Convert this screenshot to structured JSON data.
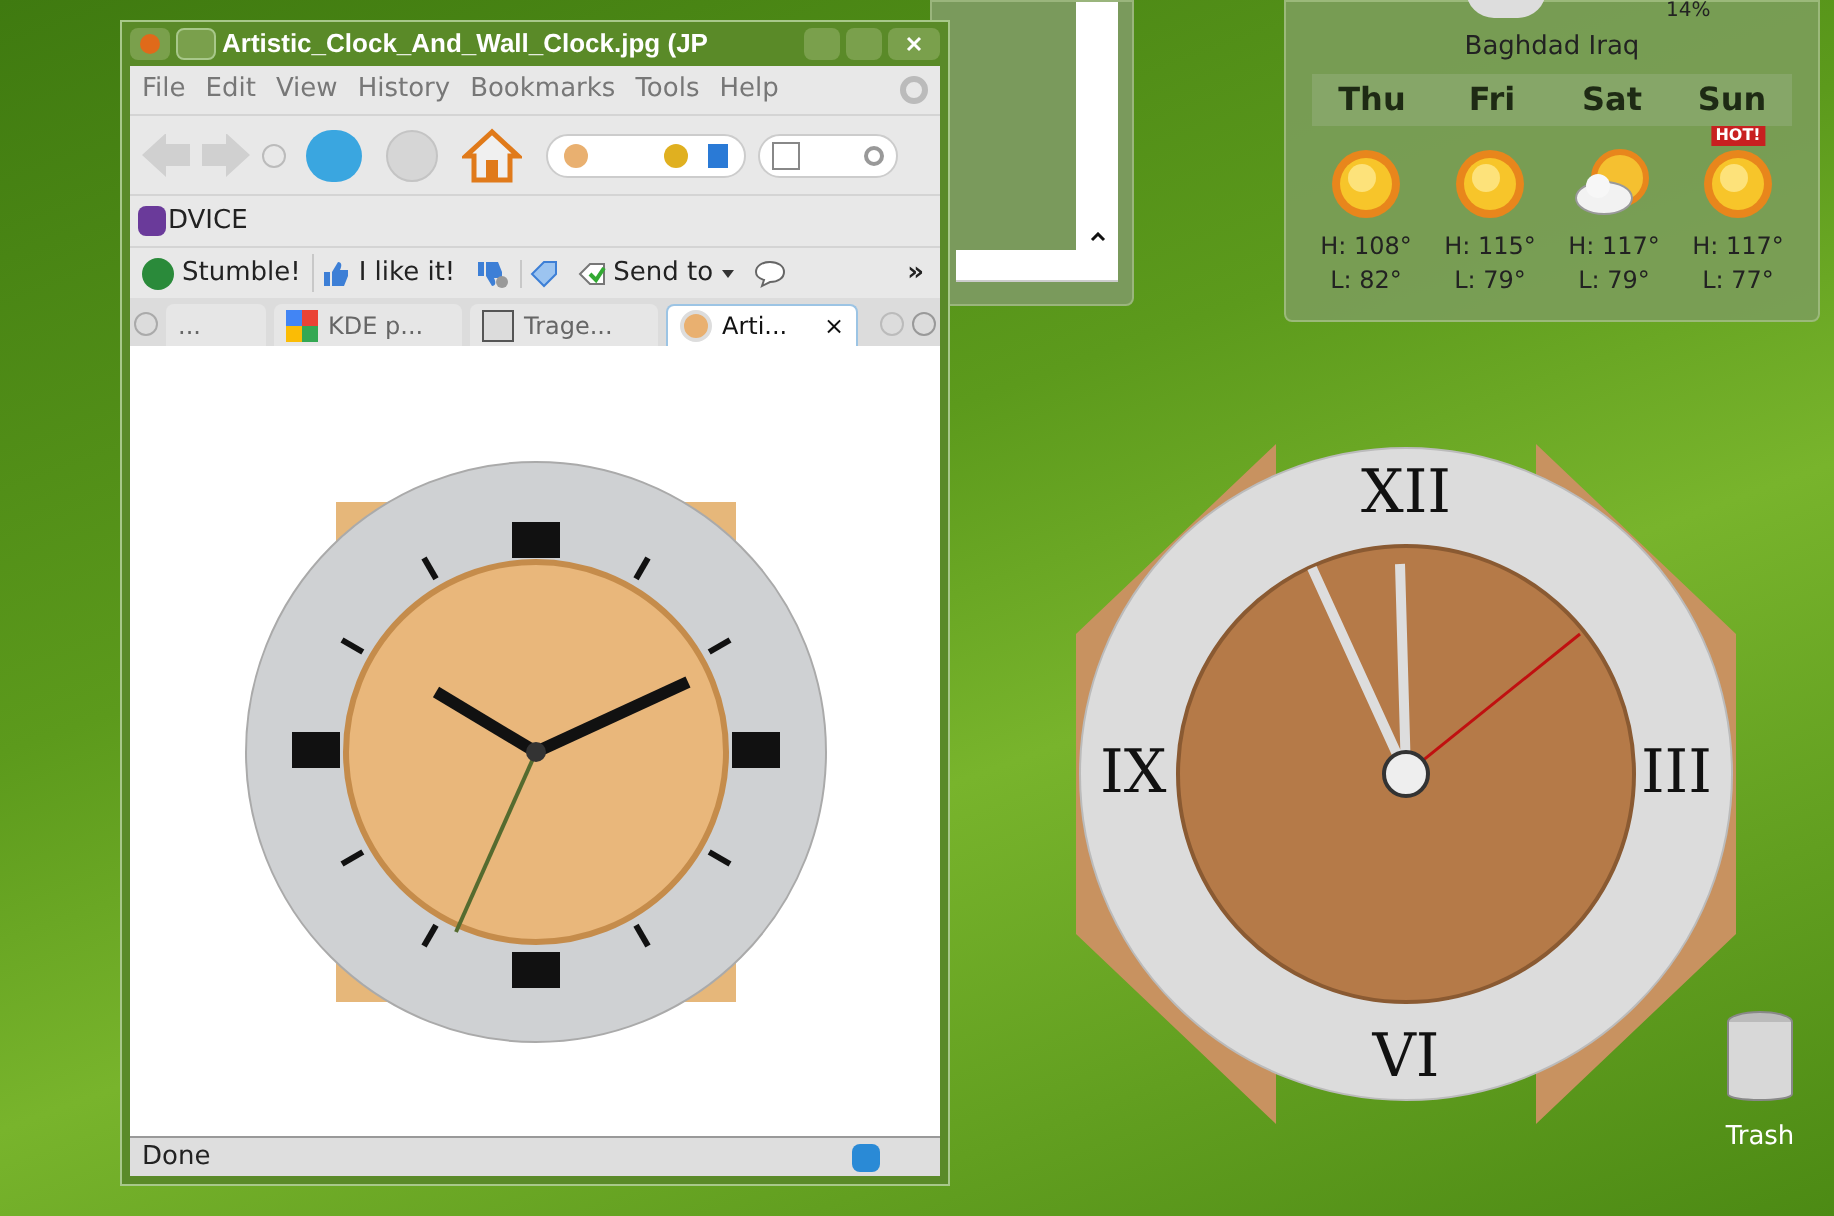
{
  "browser": {
    "title": "Artistic_Clock_And_Wall_Clock.jpg (JP",
    "menu": [
      "File",
      "Edit",
      "View",
      "History",
      "Bookmarks",
      "Tools",
      "Help"
    ],
    "bookmarks": [
      "DVICE"
    ],
    "toolbar": [
      {
        "kind": "stumble",
        "label": "Stumble!"
      },
      {
        "kind": "like",
        "label": "I like it!"
      },
      {
        "kind": "dislike"
      },
      {
        "kind": "tag"
      },
      {
        "kind": "send",
        "label": "Send to"
      },
      {
        "kind": "comment"
      }
    ],
    "overflow": "»",
    "tabs": [
      {
        "label": "...",
        "selected": false,
        "kind": "partial"
      },
      {
        "label": "KDE p...",
        "selected": false,
        "kind": "google"
      },
      {
        "label": "Trage...",
        "selected": false,
        "kind": "kde"
      },
      {
        "label": "Arti...",
        "selected": true,
        "kind": "clock",
        "close": "×"
      }
    ],
    "status": "Done"
  },
  "weather": {
    "humidity": "14%",
    "location": "Baghdad Iraq",
    "days": [
      {
        "name": "Thu",
        "kind": "sun",
        "high": "H: 108°",
        "low": "L: 82°"
      },
      {
        "name": "Fri",
        "kind": "sun",
        "high": "H: 115°",
        "low": "L: 79°"
      },
      {
        "name": "Sat",
        "kind": "cloudy",
        "high": "H: 117°",
        "low": "L: 79°"
      },
      {
        "name": "Sun",
        "kind": "sun",
        "badge": "HOT!",
        "high": "H: 117°",
        "low": "L: 77°"
      }
    ]
  },
  "clock": {
    "numerals": [
      "XII",
      "III",
      "VI",
      "IX"
    ]
  },
  "desktop": {
    "trash": "Trash"
  }
}
